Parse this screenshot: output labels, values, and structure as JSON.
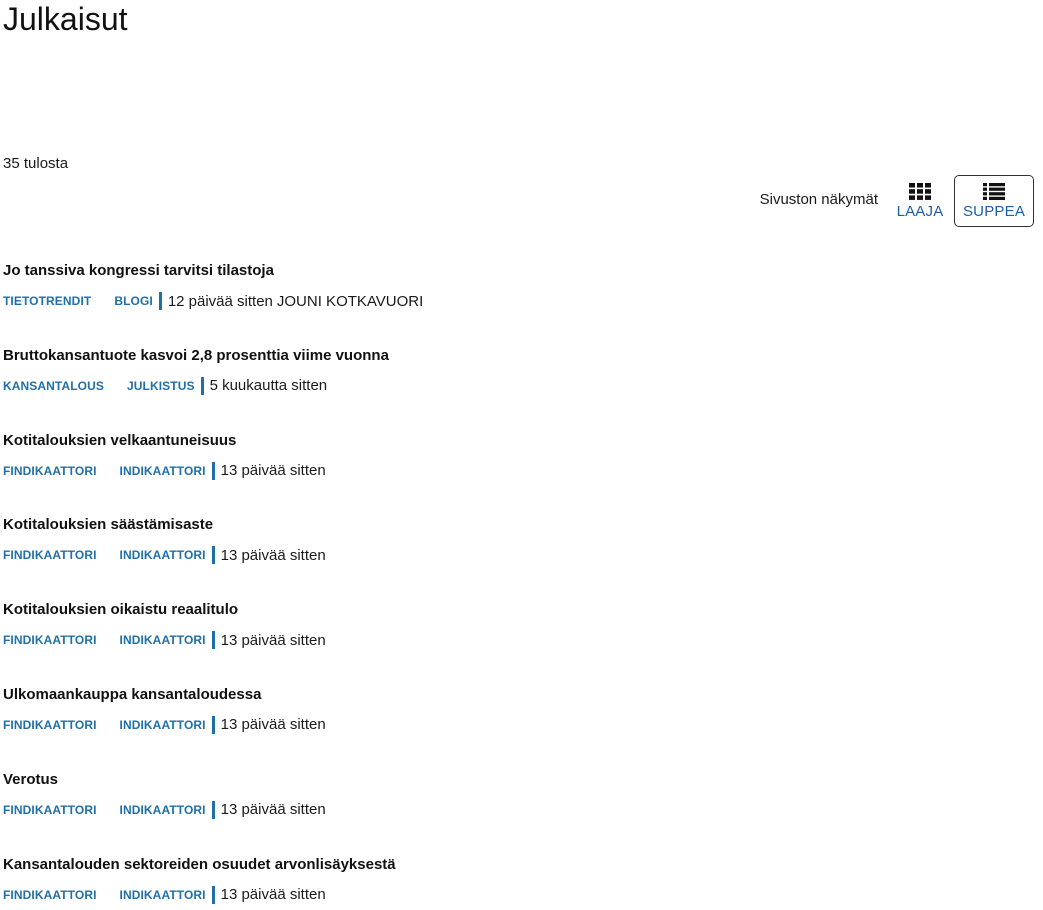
{
  "page": {
    "title": "Julkaisut"
  },
  "results": {
    "count_label": "35 tulosta"
  },
  "views": {
    "label": "Sivuston näkymät",
    "wide_label": "LAAJA",
    "compact_label": "SUPPEA",
    "wide_icon": "grid-icon",
    "compact_icon": "list-icon"
  },
  "colors": {
    "link": "#1f6fa8",
    "view_link": "#1a5fa8"
  },
  "items": [
    {
      "title": "Jo tanssiva kongressi tarvitsi tilastoja",
      "tag1": "TIETOTRENDIT",
      "tag2": "BLOGI",
      "time": "12 päivää sitten",
      "author": "JOUNI KOTKAVUORI"
    },
    {
      "title": "Bruttokansantuote kasvoi 2,8 prosenttia viime vuonna",
      "tag1": "KANSANTALOUS",
      "tag2": "JULKISTUS",
      "time": "5 kuukautta sitten",
      "author": ""
    },
    {
      "title": "Kotitalouksien velkaantuneisuus",
      "tag1": "FINDIKAATTORI",
      "tag2": "INDIKAATTORI",
      "time": "13 päivää sitten",
      "author": ""
    },
    {
      "title": "Kotitalouksien säästämisaste",
      "tag1": "FINDIKAATTORI",
      "tag2": "INDIKAATTORI",
      "time": "13 päivää sitten",
      "author": ""
    },
    {
      "title": "Kotitalouksien oikaistu reaalitulo",
      "tag1": "FINDIKAATTORI",
      "tag2": "INDIKAATTORI",
      "time": "13 päivää sitten",
      "author": ""
    },
    {
      "title": "Ulkomaankauppa kansantaloudessa",
      "tag1": "FINDIKAATTORI",
      "tag2": "INDIKAATTORI",
      "time": "13 päivää sitten",
      "author": ""
    },
    {
      "title": "Verotus",
      "tag1": "FINDIKAATTORI",
      "tag2": "INDIKAATTORI",
      "time": "13 päivää sitten",
      "author": ""
    },
    {
      "title": "Kansantalouden sektoreiden osuudet arvonlisäyksestä",
      "tag1": "FINDIKAATTORI",
      "tag2": "INDIKAATTORI",
      "time": "13 päivää sitten",
      "author": ""
    }
  ]
}
